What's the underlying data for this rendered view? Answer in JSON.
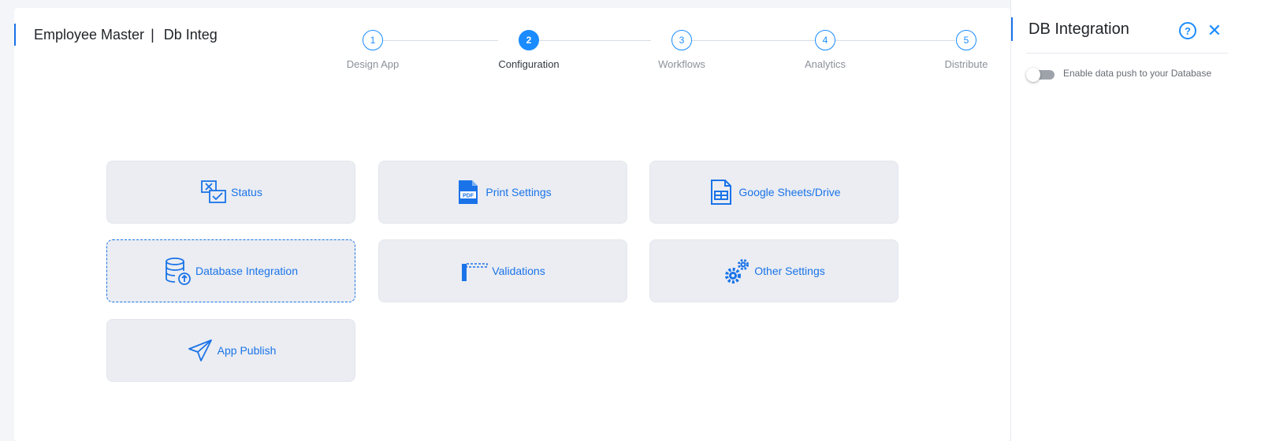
{
  "header": {
    "app_name": "Employee Master",
    "separator": "|",
    "app_sub": "Db Integ"
  },
  "steps": [
    {
      "number": "1",
      "label": "Design App",
      "active": false
    },
    {
      "number": "2",
      "label": "Configuration",
      "active": true
    },
    {
      "number": "3",
      "label": "Workflows",
      "active": false
    },
    {
      "number": "4",
      "label": "Analytics",
      "active": false
    },
    {
      "number": "5",
      "label": "Distribute",
      "active": false
    }
  ],
  "tiles": {
    "status": "Status",
    "print_settings": "Print Settings",
    "google_sheets": "Google Sheets/Drive",
    "database_integration": "Database Integration",
    "validations": "Validations",
    "other_settings": "Other Settings",
    "app_publish": "App Publish"
  },
  "panel": {
    "title": "DB Integration",
    "help_glyph": "?",
    "close_glyph": "✕",
    "toggle_label": "Enable data push to your Database",
    "toggle_on": false
  },
  "colors": {
    "accent": "#1a8cff",
    "tile_bg": "#ebedf2",
    "link": "#1a73e8"
  },
  "icons": {
    "status": "status-icon",
    "print": "pdf-icon",
    "sheets": "spreadsheet-icon",
    "database": "database-upload-icon",
    "validations": "barrier-icon",
    "other": "gears-icon",
    "publish": "paper-plane-icon"
  }
}
